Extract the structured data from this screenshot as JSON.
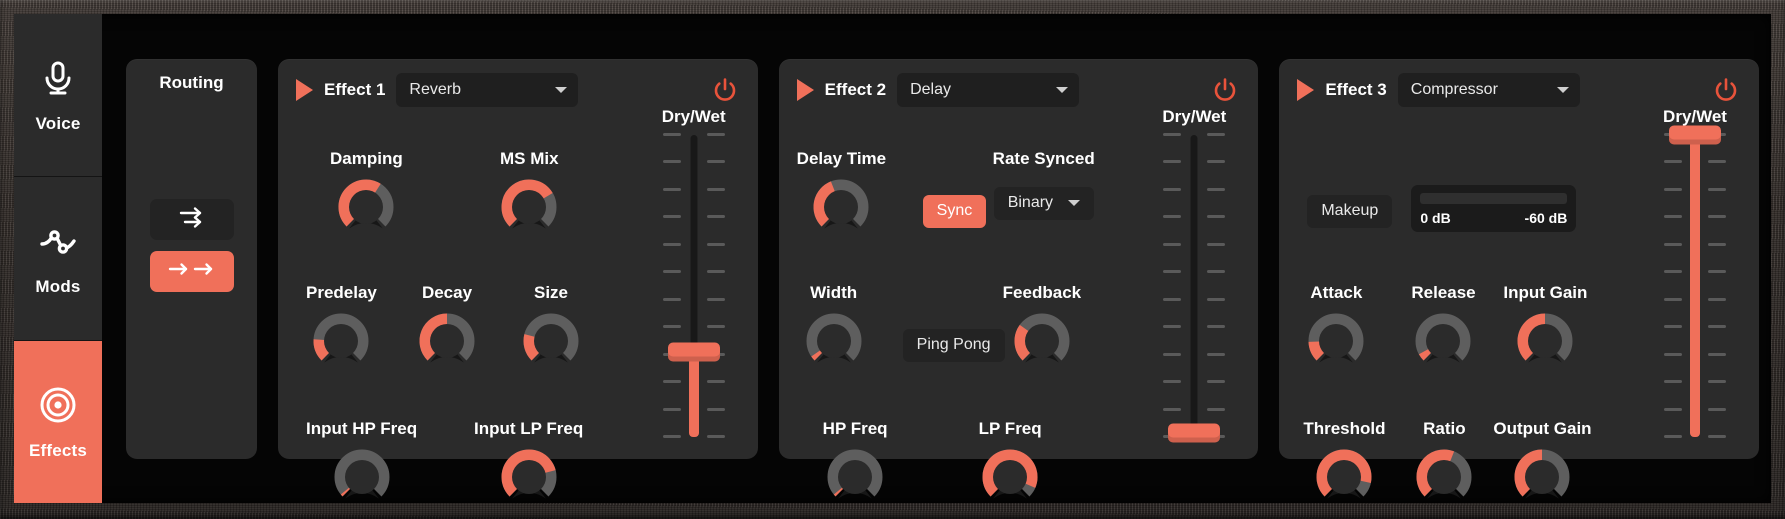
{
  "accent": "#F0705A",
  "panel_bg": "#2b2b2b",
  "sidebar": {
    "items": [
      {
        "label": "Voice",
        "icon": "microphone-icon",
        "active": false
      },
      {
        "label": "Mods",
        "icon": "mod-curve-icon",
        "active": false
      },
      {
        "label": "Effects",
        "icon": "target-icon",
        "active": true
      }
    ]
  },
  "routing": {
    "title": "Routing",
    "buttons": [
      {
        "name": "parallel-routing",
        "icon": "parallel-arrows-icon",
        "active": false
      },
      {
        "name": "serial-routing",
        "icon": "serial-arrows-icon",
        "active": true
      }
    ]
  },
  "effects": [
    {
      "slot_label": "Effect 1",
      "type": "Reverb",
      "enabled": true,
      "power_icon": "power-icon",
      "play_icon": "play-triangle-icon",
      "knobs": [
        {
          "label": "Damping",
          "value": 0.62
        },
        {
          "label": "MS Mix",
          "value": 0.72
        },
        {
          "label": "Predelay",
          "value": 0.18
        },
        {
          "label": "Decay",
          "value": 0.5
        },
        {
          "label": "Size",
          "value": 0.22
        },
        {
          "label": "Input HP Freq",
          "value": 0.02
        },
        {
          "label": "Input LP Freq",
          "value": 0.78
        }
      ],
      "fader": {
        "label": "Dry/Wet",
        "value": 0.28
      }
    },
    {
      "slot_label": "Effect 2",
      "type": "Delay",
      "enabled": true,
      "power_icon": "power-icon",
      "play_icon": "play-triangle-icon",
      "knobs": [
        {
          "label": "Delay Time",
          "value": 0.42
        },
        {
          "label": "Width",
          "value": 0.04
        },
        {
          "label": "Feedback",
          "value": 0.3
        },
        {
          "label": "HP Freq",
          "value": 0.02
        },
        {
          "label": "LP Freq",
          "value": 0.92
        }
      ],
      "buttons": [
        {
          "label": "Sync",
          "active": true
        },
        {
          "label": "Ping Pong",
          "active": false
        }
      ],
      "rate_synced": {
        "label": "Rate Synced",
        "value": "Binary"
      },
      "fader": {
        "label": "Dry/Wet",
        "value": 0.01
      }
    },
    {
      "slot_label": "Effect 3",
      "type": "Compressor",
      "enabled": true,
      "power_icon": "power-icon",
      "play_icon": "play-triangle-icon",
      "knobs": [
        {
          "label": "Attack",
          "value": 0.16
        },
        {
          "label": "Release",
          "value": 0.06
        },
        {
          "label": "Input Gain",
          "value": 0.5
        },
        {
          "label": "Threshold",
          "value": 0.88
        },
        {
          "label": "Ratio",
          "value": 0.58
        },
        {
          "label": "Output Gain",
          "value": 0.5
        }
      ],
      "buttons": [
        {
          "label": "Makeup",
          "active": false
        }
      ],
      "meter": {
        "min_label": "0 dB",
        "max_label": "-60 dB",
        "value": 0.0
      },
      "fader": {
        "label": "Dry/Wet",
        "value": 1.0
      }
    }
  ]
}
